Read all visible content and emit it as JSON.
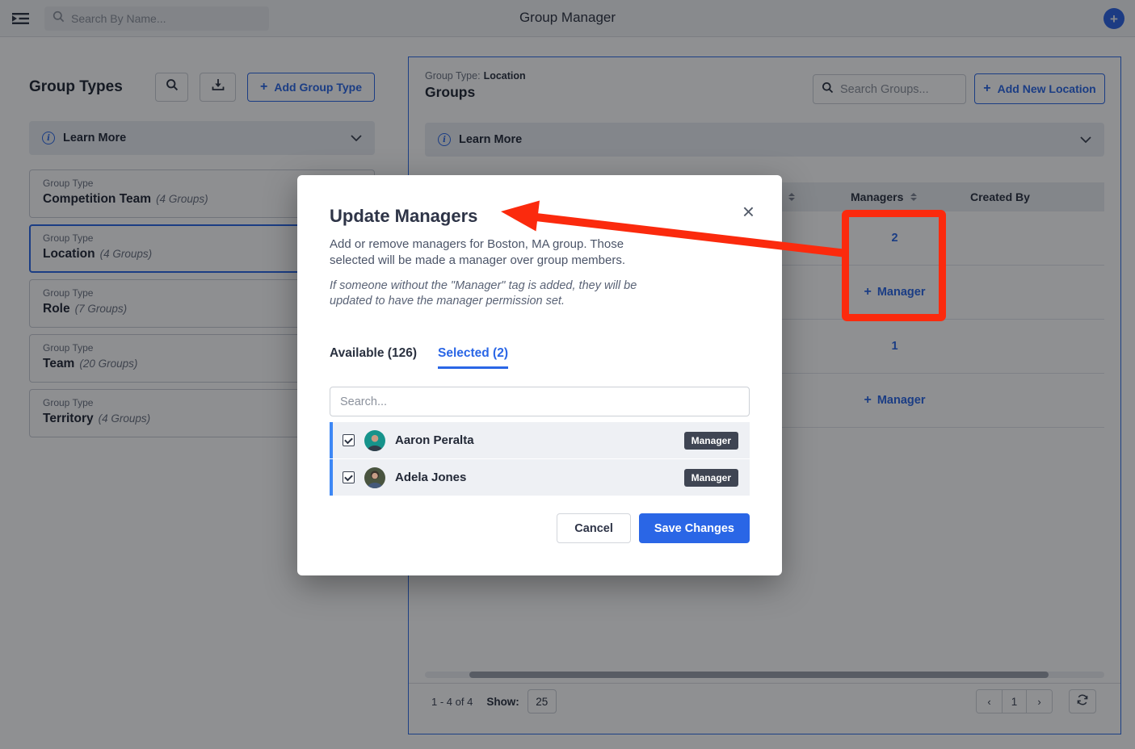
{
  "glyphs": {
    "plus": "+",
    "info": "i"
  },
  "topbar": {
    "search_placeholder": "Search By Name...",
    "title": "Group Manager"
  },
  "left_panel": {
    "title": "Group Types",
    "add_button": "Add Group Type",
    "learn_more": "Learn More",
    "items": [
      {
        "label": "Group Type",
        "name": "Competition Team",
        "count": "(4 Groups)"
      },
      {
        "label": "Group Type",
        "name": "Location",
        "count": "(4 Groups)"
      },
      {
        "label": "Group Type",
        "name": "Role",
        "count": "(7 Groups)"
      },
      {
        "label": "Group Type",
        "name": "Team",
        "count": "(20 Groups)"
      },
      {
        "label": "Group Type",
        "name": "Territory",
        "count": "(4 Groups)"
      }
    ]
  },
  "right_panel": {
    "group_type_label": "Group Type:",
    "group_type_value": "Location",
    "title": "Groups",
    "search_placeholder": "Search Groups...",
    "add_button": "Add New Location",
    "learn_more": "Learn More",
    "table": {
      "col_managers": "Managers",
      "col_created_by": "Created By",
      "rows": [
        {
          "count": "2"
        },
        {
          "add": "Manager"
        },
        {
          "count": "1"
        },
        {
          "add": "Manager"
        }
      ]
    },
    "footer": {
      "range": "1 - 4 of 4",
      "show_label": "Show:",
      "page_size": "25",
      "prev": "‹",
      "page": "1",
      "next": "›"
    }
  },
  "modal": {
    "title": "Update Managers",
    "close": "×",
    "description": "Add or remove managers for Boston, MA group. Those selected will be made a manager over group members.",
    "note": "If someone without the \"Manager\" tag is added, they will be updated to have the manager permission set.",
    "tab_available": "Available (126)",
    "tab_selected": "Selected (2)",
    "search_placeholder": "Search...",
    "people": [
      {
        "name": "Aaron Peralta",
        "badge": "Manager"
      },
      {
        "name": "Adela Jones",
        "badge": "Manager"
      }
    ],
    "cancel": "Cancel",
    "save": "Save Changes"
  },
  "colors": {
    "accent_blue": "#2a66e6",
    "annotation_red": "#fb2a0d",
    "badge_dark": "#3f4553",
    "row_bar_blue": "#3d87f5"
  }
}
